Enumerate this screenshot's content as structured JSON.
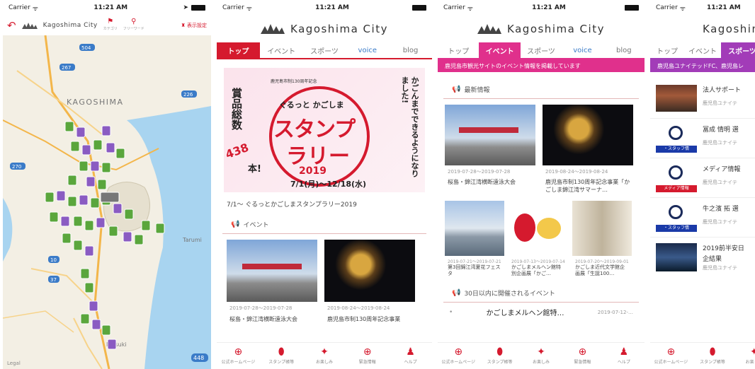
{
  "status": {
    "carrier": "Carrier",
    "time": "11:21 AM"
  },
  "brand": {
    "name": "Kagoshima City"
  },
  "map_screen": {
    "toolbar_brand": "Kagoshima City",
    "tool1_label": "カテゴリ",
    "tool2_label": "フリーワード",
    "setting_label": "表示設定",
    "labels": {
      "kagoshima": "KAGOSHIMA",
      "tarumi": "Tarumi",
      "ibusuki": "Ibusuki",
      "legal": "Legal"
    },
    "road_badges": [
      "504",
      "267",
      "270",
      "10",
      "37",
      "226",
      "448"
    ]
  },
  "tabs": [
    "トップ",
    "イベント",
    "スポーツ",
    "voice",
    "blog"
  ],
  "top_screen": {
    "banner_text": {
      "left": "賞品総数",
      "count": "438",
      "unit": "本!",
      "small": "鹿児島市制130周年記念",
      "line1": "ぐるっと かごしま",
      "big1": "スタンプ",
      "big2": "ラリー",
      "year": "2019",
      "dates": "7/1(月)～12/18(水)",
      "right": "かごんまでできるようになりました!"
    },
    "banner_caption": "7/1～ ぐるっとかごしまスタンプラリー2019",
    "section": "イベント",
    "events": [
      {
        "date": "2019-07-28～2019-07-28",
        "title": "桜島・錦江湾横断遠泳大会"
      },
      {
        "date": "2019-08-24～2019-08-24",
        "title": "鹿児島市制130周年記念事業"
      }
    ]
  },
  "event_screen": {
    "banner": "鹿児島市観光サイトのイベント情報を掲載しています",
    "section1": "最新情報",
    "events": [
      {
        "date": "2019-07-28～2019-07-28",
        "title": "桜島・錦江湾横断遠泳大会"
      },
      {
        "date": "2019-08-24～2019-08-24",
        "title": "鹿児島市制130周年記念事業「かごしま錦江湾サマーナ…"
      }
    ],
    "small_events": [
      {
        "date": "2019-07-21～2019-07-21",
        "title": "第3回錦江湾夏花フェスタ"
      },
      {
        "date": "2019-07-13～2019-07-14",
        "title": "かごしまメルヘン館特別企画展「かご…"
      },
      {
        "date": "2019-07-20～2019-09-01",
        "title": "かごしま近代文学館企画展「生誕100…"
      }
    ],
    "section2": "30日以内に開催されるイベント",
    "upcoming": {
      "title": "かごしまメルヘン館特…",
      "date": "2019-07-12-…"
    }
  },
  "sports_screen": {
    "banner": "鹿児島ユナイテッドFC、鹿児島レ",
    "items": [
      {
        "title": "法人サポート",
        "sub": "鹿児島ユナイテ"
      },
      {
        "title": "冨成 情明 選",
        "sub": "鹿児島ユナイテ"
      },
      {
        "title": "メディア情報",
        "sub": "鹿児島ユナイテ"
      },
      {
        "title": "牛之濱 拓 選",
        "sub": "鹿児島ユナイテ"
      },
      {
        "title": "2019前半安日",
        "title2": "企結果",
        "sub": "鹿児島ユナイテ"
      }
    ],
    "thumb_labels": [
      "・スタッフ情",
      "メディア情報",
      "・スタッフ情"
    ]
  },
  "bottom_nav": [
    "公式ホームページ",
    "スタンプ帳等",
    "お楽しみ",
    "緊急情報",
    "ヘルプ"
  ],
  "colors": {
    "accent_red": "#d51a2e",
    "accent_pink": "#e0308c",
    "accent_purple": "#a23cb8"
  }
}
